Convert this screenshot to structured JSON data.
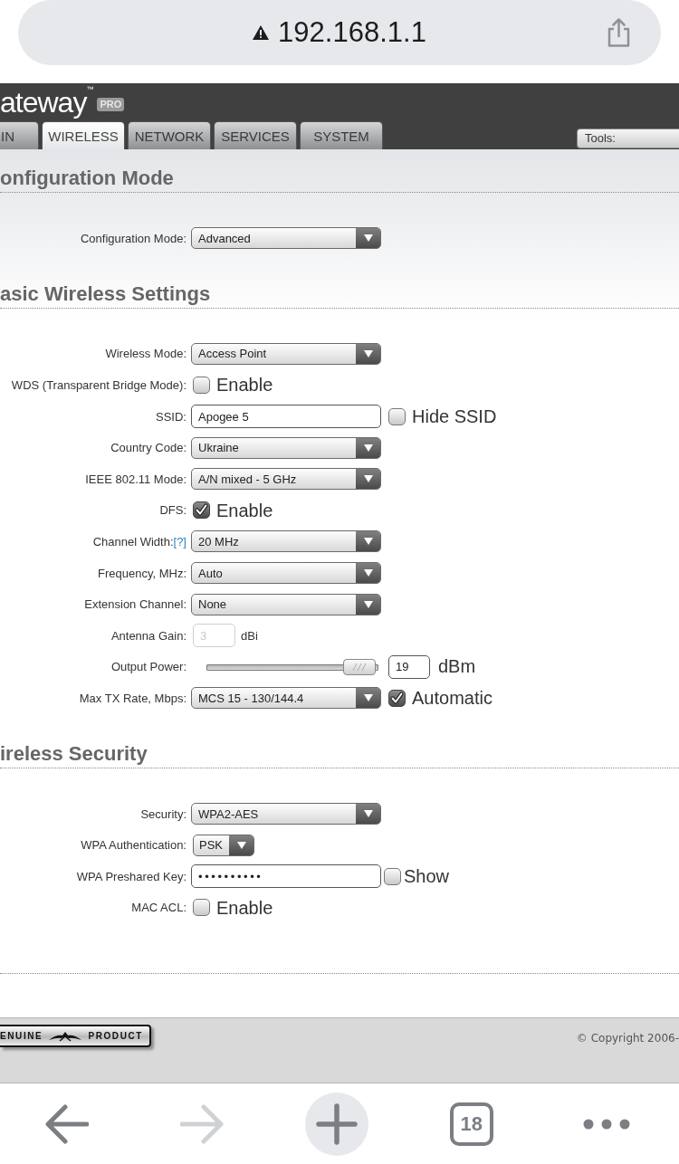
{
  "address_bar": {
    "url": "192.168.1.1"
  },
  "header": {
    "logo": "ateway$^{™}$",
    "badge": "PRO"
  },
  "tabs": [
    {
      "label": "IN",
      "selected": false
    },
    {
      "label": "WIRELESS",
      "selected": true
    },
    {
      "label": "NETWORK",
      "selected": false
    },
    {
      "label": "SERVICES",
      "selected": false
    },
    {
      "label": "SYSTEM",
      "selected": false
    }
  ],
  "tools": {
    "label": "Tools:"
  },
  "sections": [
    {
      "title": "onfiguration Mode",
      "rows": [
        {
          "kind": "select",
          "label": "Configuration Mode:",
          "value": "Advanced"
        }
      ]
    },
    {
      "title": "asic Wireless Settings",
      "rows": [
        {
          "kind": "select",
          "label": "Wireless Mode:",
          "value": "Access Point"
        },
        {
          "kind": "checkbox",
          "label": "WDS (Transparent Bridge Mode):",
          "text": "Enable",
          "checked": false
        },
        {
          "kind": "text",
          "label": "SSID:",
          "value": "Apogee 5",
          "option": {
            "text": "Hide SSID",
            "checked": false
          }
        },
        {
          "kind": "select",
          "label": "Country Code:",
          "value": "Ukraine"
        },
        {
          "kind": "select",
          "label": "IEEE 802.11 Mode:",
          "value": "A/N mixed - 5 GHz"
        },
        {
          "kind": "checkbox",
          "label": "DFS:",
          "text": "Enable",
          "checked": true
        },
        {
          "kind": "select",
          "label": "Channel Width:",
          "help": "[?]",
          "value": "20 MHz"
        },
        {
          "kind": "select",
          "label": "Frequency, MHz:",
          "value": "Auto"
        },
        {
          "kind": "select",
          "label": "Extension Channel:",
          "value": "None"
        },
        {
          "kind": "number",
          "label": "Antenna Gain:",
          "value": "3",
          "unit": "dBi",
          "disabled": true
        },
        {
          "kind": "slider",
          "label": "Output Power:",
          "level": 0.98,
          "value": "19",
          "unit": "dBm"
        },
        {
          "kind": "select",
          "label": "Max TX Rate, Mbps:",
          "value": "MCS 15 - 130/144.4",
          "option": {
            "text": "Automatic",
            "checked": true
          }
        }
      ]
    },
    {
      "title": "ireless Security",
      "rows": [
        {
          "kind": "select",
          "label": "Security:",
          "value": "WPA2-AES"
        },
        {
          "kind": "compact",
          "label": "WPA Authentication:",
          "value": "PSK"
        },
        {
          "kind": "password",
          "label": "WPA Preshared Key:",
          "value": "••••••••••",
          "option": {
            "text": "Show",
            "checked": false
          }
        },
        {
          "kind": "checkbox",
          "label": "MAC ACL:",
          "text": "Enable",
          "checked": false
        }
      ]
    }
  ],
  "footer": {
    "badge": [
      "ENUINE",
      "PRODUCT"
    ],
    "copyright": "© Copyright 2006-"
  },
  "toolbar_buttons": [
    {
      "kind": "back",
      "disabled": false
    },
    {
      "kind": "forward",
      "disabled": true
    },
    {
      "kind": "new_tab",
      "disabled": false
    },
    {
      "kind": "tabs",
      "count": "18",
      "disabled": false
    },
    {
      "kind": "more",
      "disabled": false
    }
  ]
}
